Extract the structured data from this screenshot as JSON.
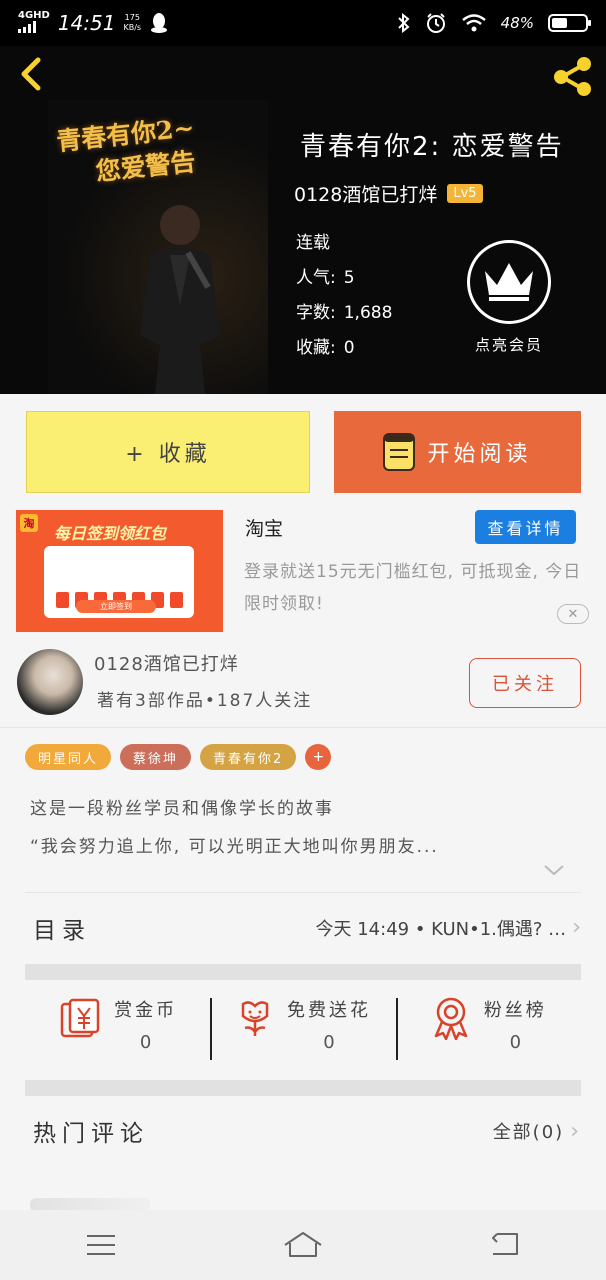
{
  "status_bar": {
    "network": "4GHD",
    "time": "14:51",
    "speed_value": "175",
    "speed_unit": "KB/s",
    "battery": "48%",
    "battery_level": 0.48
  },
  "book": {
    "cover_title_line1": "青春有你2~",
    "cover_title_line2": "您爱警告",
    "title": "青春有你2:  恋爱警告",
    "author": "0128酒馆已打烊",
    "level": "Lv5",
    "status": "连载",
    "popularity_label": "人气:",
    "popularity": "5",
    "words_label": "字数:",
    "words": "1,688",
    "favorites_label": "收藏:",
    "favorites": "0"
  },
  "vip": {
    "label": "点亮会员"
  },
  "actions": {
    "favorite_label": "+ 收藏",
    "read_label": "开始阅读"
  },
  "ad": {
    "logo": "淘",
    "headline": "每日签到领红包",
    "cta": "立即签到",
    "source": "淘宝",
    "detail_button": "查看详情",
    "text": "登录就送15元无门槛红包, 可抵现金, 今日限时领取!",
    "close": "✕"
  },
  "author_card": {
    "name": "0128酒馆已打烊",
    "stats": "著有3部作品•187人关注",
    "follow_label": "已关注"
  },
  "tags": [
    {
      "label": "明星同人",
      "color": "#f0a93a"
    },
    {
      "label": "蔡徐坤",
      "color": "#cc6f5a"
    },
    {
      "label": "青春有你2",
      "color": "#d4a343"
    }
  ],
  "tag_add": "+",
  "description": {
    "line1": "这是一段粉丝学员和偶像学长的故事",
    "line2": "“我会努力追上你, 可以光明正大地叫你男朋友..."
  },
  "catalog": {
    "label": "目录",
    "latest": "今天 14:49 • KUN•1.偶遇? …"
  },
  "gifts": [
    {
      "label": "赏金币",
      "count": "0",
      "icon": "red-envelope-icon"
    },
    {
      "label": "免费送花",
      "count": "0",
      "icon": "flower-icon"
    },
    {
      "label": "粉丝榜",
      "count": "0",
      "icon": "medal-icon"
    }
  ],
  "comments": {
    "title": "热门评论",
    "all_label": "全部(0)"
  }
}
